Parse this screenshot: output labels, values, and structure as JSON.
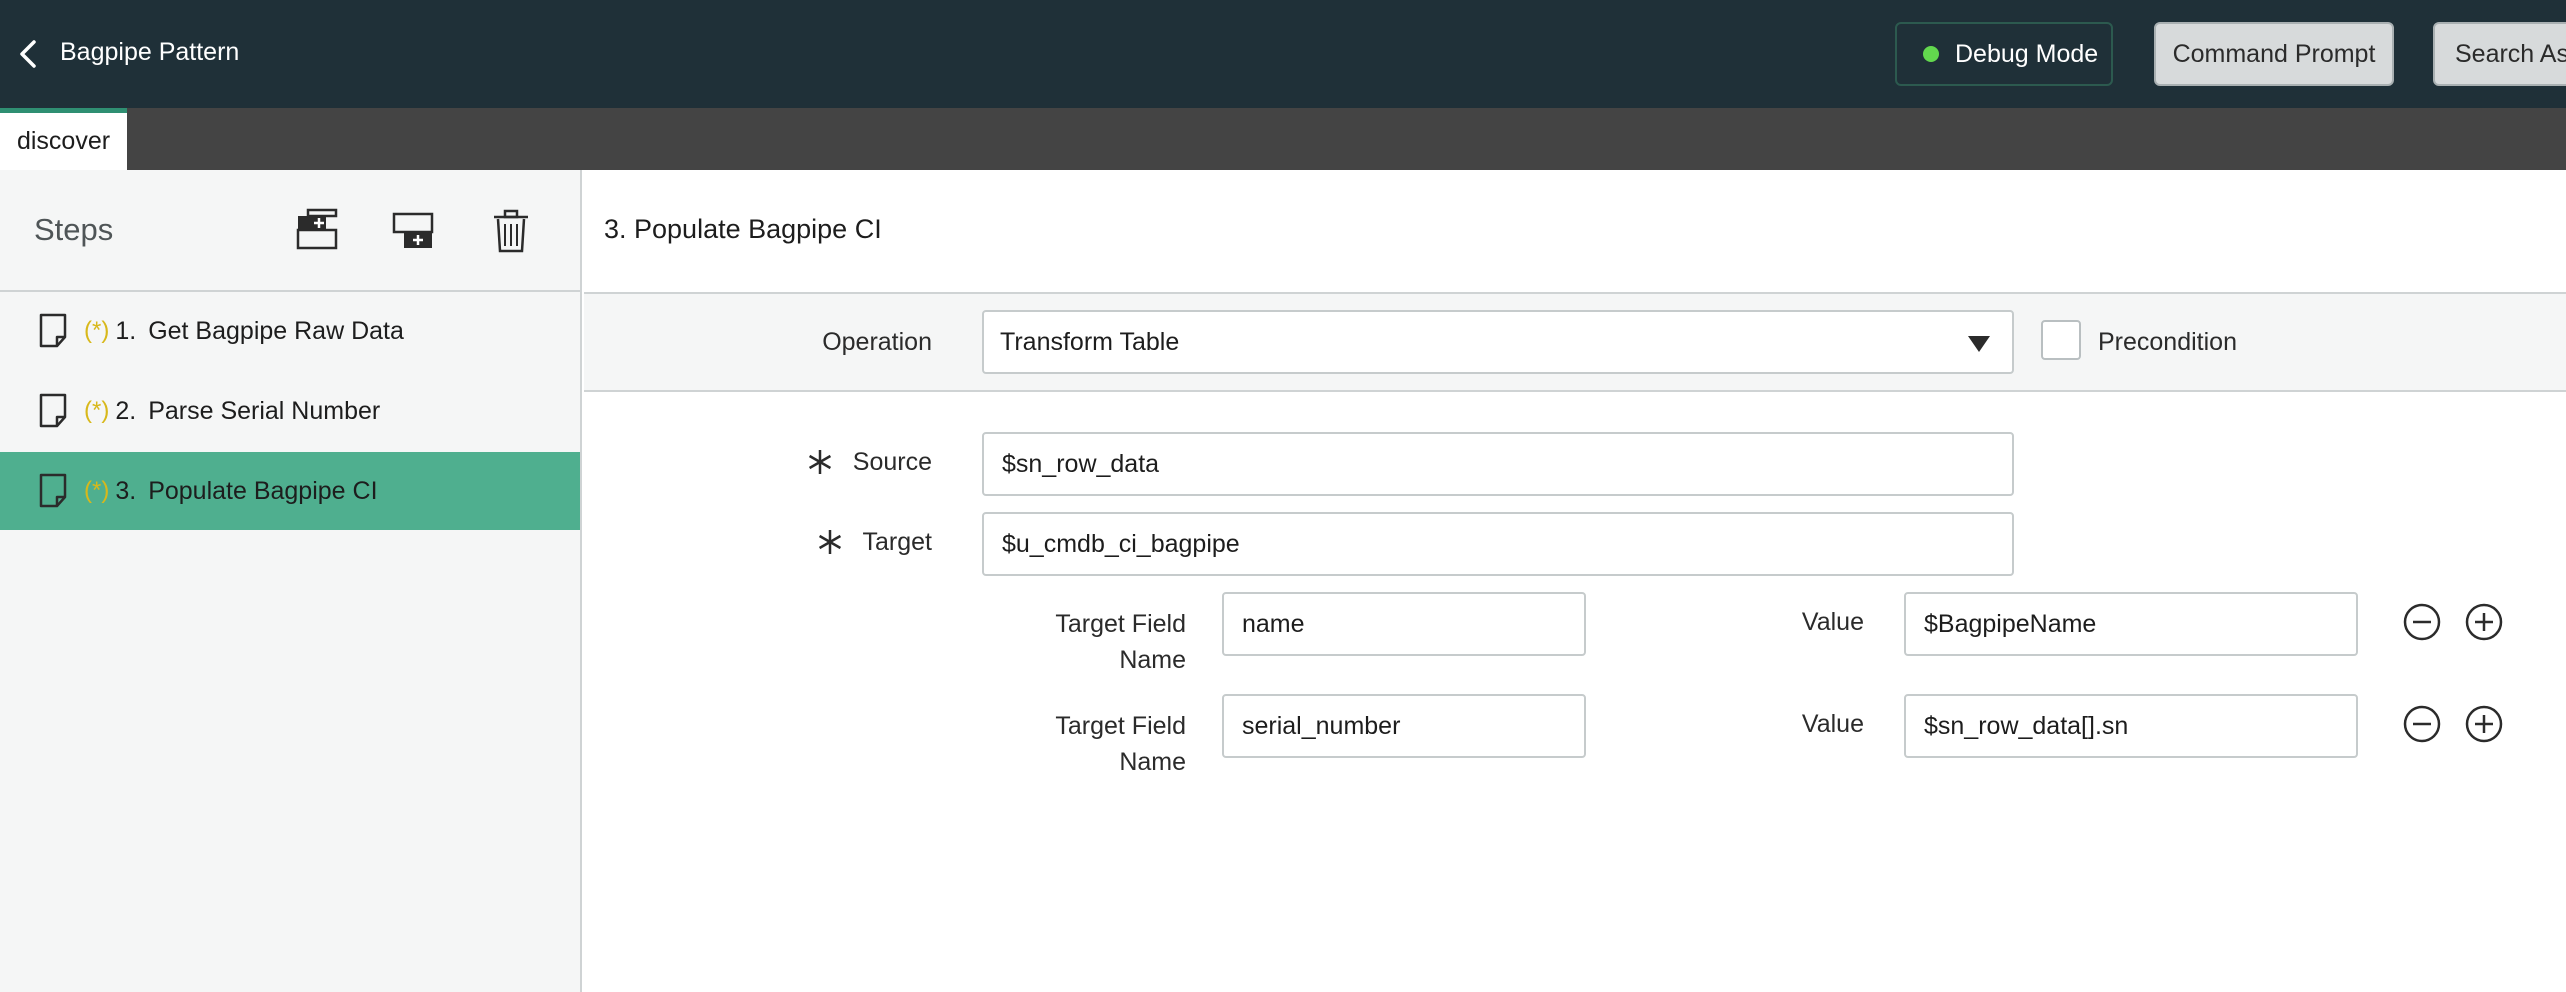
{
  "header": {
    "back_icon": "chevron-left-icon",
    "title": "Bagpipe Pattern",
    "debug_label": "Debug Mode",
    "debug_status_color": "#62d84e",
    "command_prompt_label": "Command Prompt",
    "search_label": "Search Ass"
  },
  "tabs": [
    {
      "label": "discover",
      "active": true
    }
  ],
  "sidebar": {
    "title": "Steps",
    "tools": [
      "add-step-above-icon",
      "add-step-below-icon",
      "trash-icon"
    ],
    "steps": [
      {
        "required_mark": "(*)",
        "number": "1.",
        "label": "Get Bagpipe Raw Data",
        "active": false
      },
      {
        "required_mark": "(*)",
        "number": "2.",
        "label": "Parse Serial Number",
        "active": false
      },
      {
        "required_mark": "(*)",
        "number": "3.",
        "label": "Populate Bagpipe CI",
        "active": true
      }
    ]
  },
  "main": {
    "step_title": "3. Populate Bagpipe CI",
    "operation": {
      "label": "Operation",
      "value": "Transform Table",
      "precondition_label": "Precondition",
      "precondition_checked": false
    },
    "source": {
      "label": "Source",
      "value": "$sn_row_data"
    },
    "target": {
      "label": "Target",
      "value": "$u_cmdb_ci_bagpipe"
    },
    "mappings": [
      {
        "field_label_1": "Target Field",
        "field_label_2": "Name",
        "field_value": "name",
        "value_label": "Value",
        "value": "$BagpipeName"
      },
      {
        "field_label_1": "Target Field",
        "field_label_2": "Name",
        "field_value": "serial_number",
        "value_label": "Value",
        "value": "$sn_row_data[].sn"
      }
    ]
  },
  "colors": {
    "header_bg": "#1f3038",
    "tabstrip_bg": "#444444",
    "accent_green": "#4faf8f",
    "required_yellow": "#d8b81a"
  }
}
